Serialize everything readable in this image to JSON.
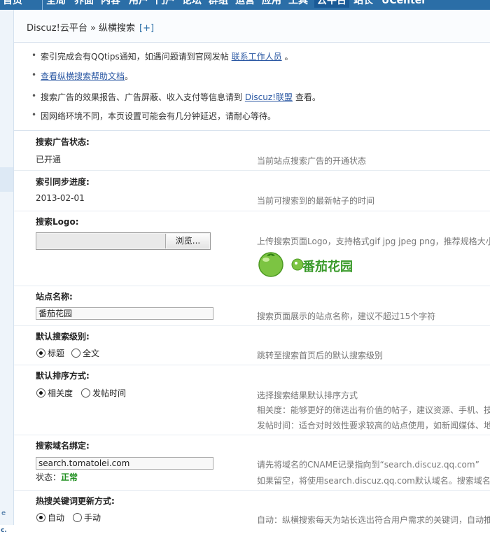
{
  "nav": {
    "items": [
      "首页",
      "全局",
      "界面",
      "内容",
      "用户",
      "门户",
      "论坛",
      "群组",
      "运营",
      "应用",
      "工具",
      "云平台",
      "站长",
      "UCenter"
    ],
    "active": "云平台"
  },
  "breadcrumb": {
    "path": "Discuz!云平台 » 纵横搜索",
    "expand": "[+]"
  },
  "tips": {
    "t1_text": "索引完成会有QQtips通知，如遇问题请到官网发帖",
    "t1_link": "联系工作人员",
    "t1_end": "。",
    "t2_link": "查看纵横搜索帮助文档",
    "t2_end": "。",
    "t3_text": "搜索广告的效果报告、广告屏蔽、收入支付等信息请到",
    "t3_link": "Discuz!联盟",
    "t3_end": "查看。",
    "t4_text": "因网络环境不同，本页设置可能会有几分钟延迟，请耐心等待。"
  },
  "form": {
    "ad_status": {
      "label": "搜索广告状态:",
      "value": "已开通",
      "help": "当前站点搜索广告的开通状态"
    },
    "index_progress": {
      "label": "索引同步进度:",
      "value": "2013-02-01",
      "help": "当前可搜索到的最新帖子的时间"
    },
    "logo": {
      "label": "搜索Logo:",
      "browse": "浏览...",
      "help": "上传搜索页面Logo，支持格式gif jpg jpeg png，推荐规格大小",
      "logo_text": "番茄花园"
    },
    "site_name": {
      "label": "站点名称:",
      "value": "番茄花园",
      "help": "搜索页面展示的站点名称，建议不超过15个字符"
    },
    "search_level": {
      "label": "默认搜索级别:",
      "opt1": "标题",
      "opt2": "全文",
      "help": "跳转至搜索首页后的默认搜索级别"
    },
    "sort": {
      "label": "默认排序方式:",
      "opt1": "相关度",
      "opt2": "发帖时间",
      "help1": "选择搜索结果默认排序方式",
      "help2": "相关度：能够更好的筛选出有价值的帖子，建议资源、手机、技",
      "help3": "发帖时间：适合对时效性要求较高的站点使用，如新闻媒体、地"
    },
    "domain": {
      "label": "搜索域名绑定:",
      "value": "search.tomatolei.com",
      "status_label": "状态：",
      "status_value": "正常",
      "help1": "请先将域名的CNAME记录指向到“search.discuz.qq.com”",
      "help2": "如果留空，将使用search.discuz.qq.com默认域名。搜索域名"
    },
    "hotword": {
      "label": "热搜关键词更新方式:",
      "opt1": "自动",
      "opt2": "手动",
      "help": "自动：纵横搜索每天为站长选出符合用户需求的关键词，自动推"
    }
  },
  "sidebar": {
    "tag_c": "c.",
    "tag_e": "e"
  }
}
